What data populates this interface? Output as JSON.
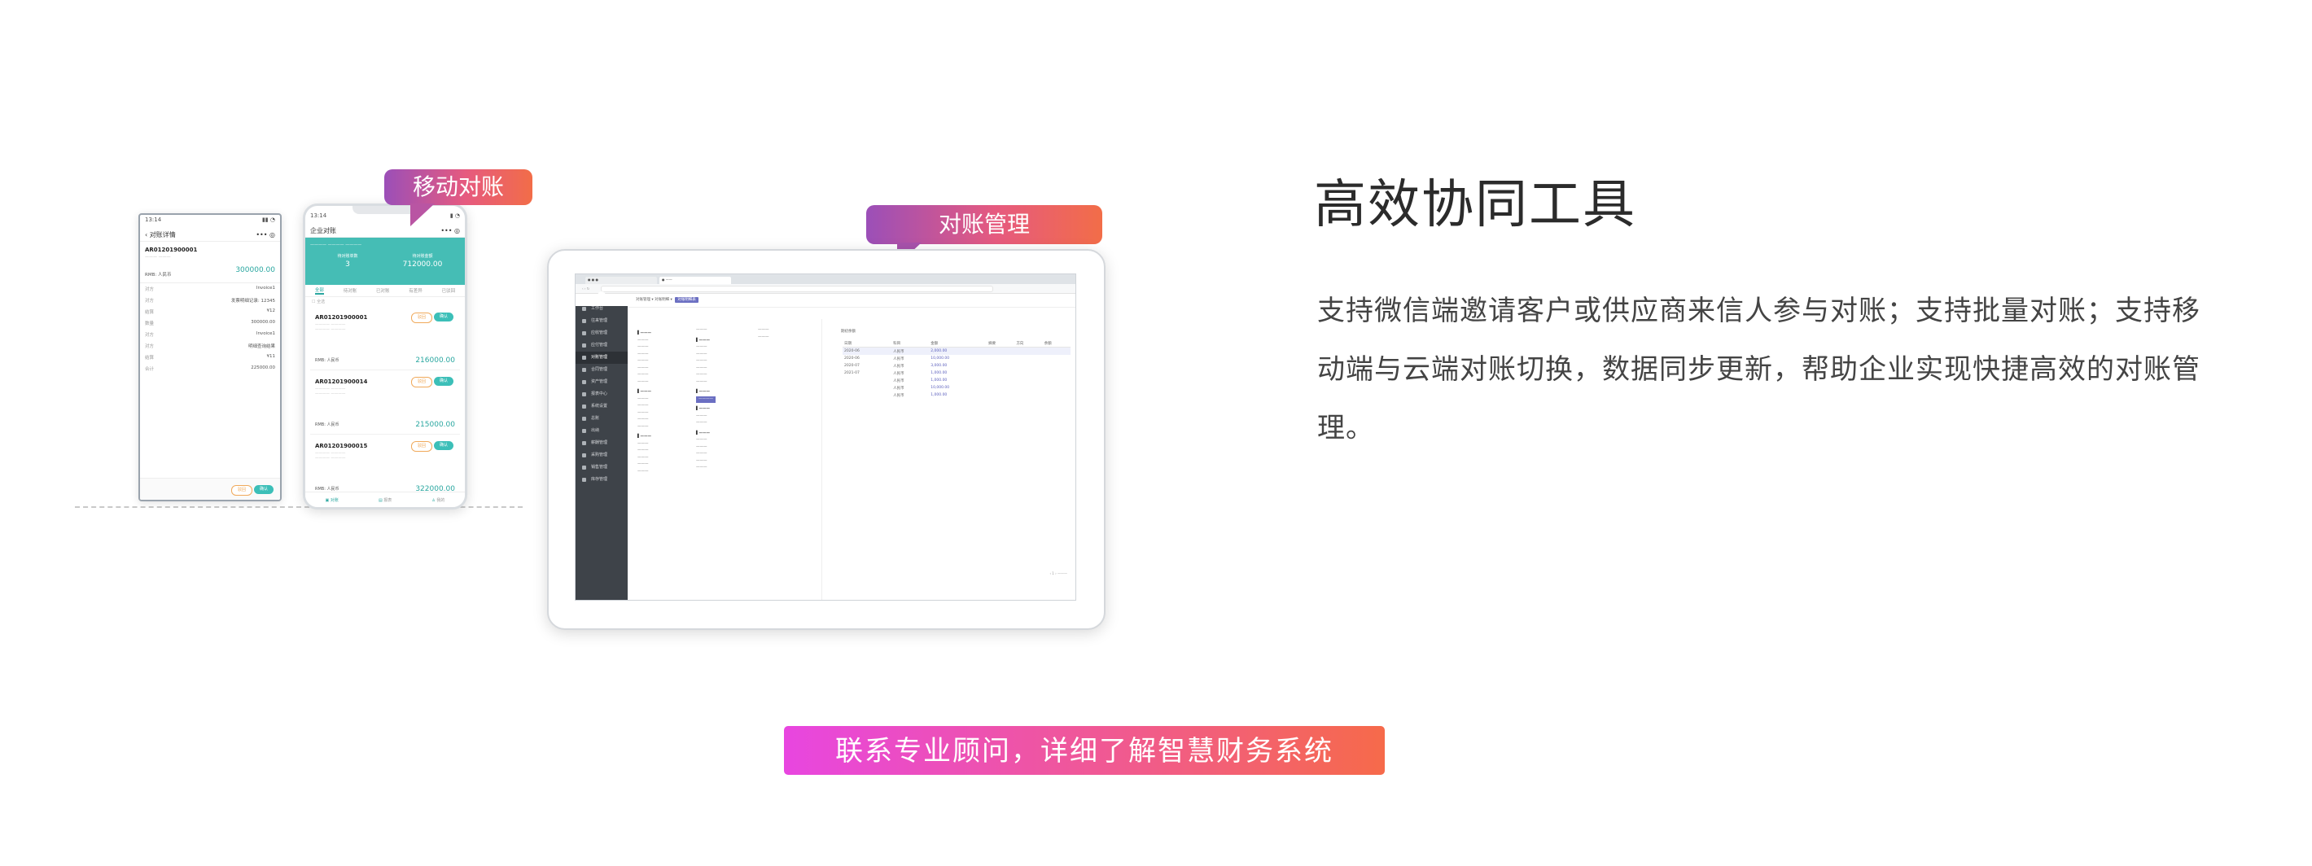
{
  "labels": {
    "mobile": "移动对账",
    "web": "对账管理"
  },
  "heading": {
    "title": "高效协同工具",
    "description": "支持微信端邀请客户或供应商来信人参与对账；支持批量对账；支持移动端与云端对账切换，数据同步更新，帮助企业实现快捷高效的对账管理。"
  },
  "cta": {
    "label": "联系专业顾问，详细了解智慧财务系统"
  },
  "phone_back": {
    "time": "13:14",
    "nav_title": "对账详情",
    "doc_code": "AR01201900001",
    "amount": "300000.00",
    "unit": "RMB: 人民币",
    "rows": [
      {
        "k": "对方",
        "v": "Invoice1"
      },
      {
        "k": "对方",
        "v": "发票明细记录: 12345"
      },
      {
        "k": "结算",
        "v": "¥12"
      },
      {
        "k": "数量",
        "v": "300000.00"
      },
      {
        "k": "对方",
        "v": "Invoice1"
      },
      {
        "k": "对方",
        "v": "明细查询结果"
      },
      {
        "k": "结算",
        "v": "¥11"
      },
      {
        "k": "合计",
        "v": "225000.00"
      }
    ],
    "btn_reject": "驳回",
    "btn_confirm": "确认"
  },
  "phone_front": {
    "time": "13:14",
    "nav_title": "企业对账",
    "stat_count_label": "待对账单数",
    "stat_count": "3",
    "stat_amount_label": "待对账金额",
    "stat_amount": "712000.00",
    "tabs": [
      "全部",
      "待对账",
      "已对账",
      "有差异",
      "已驳回"
    ],
    "select_all": "全选",
    "cards": [
      {
        "id": "AR01201900001",
        "unit": "RMB: 人民币",
        "amount": "216000.00"
      },
      {
        "id": "AR01201900014",
        "unit": "RMB: 人民币",
        "amount": "215000.00"
      },
      {
        "id": "AR01201900015",
        "unit": "RMB: 人民币",
        "amount": "322000.00"
      }
    ],
    "btn_reject": "驳回",
    "btn_confirm": "确认",
    "bottom_tabs": [
      "对账",
      "报表",
      "我的"
    ]
  },
  "web_app": {
    "breadcrumb": [
      "对账管理",
      "对账明细",
      "对账明细表"
    ],
    "sidebar": [
      "工作台",
      "往来管理",
      "应收管理",
      "应付管理",
      "对账管理",
      "合同管理",
      "资产管理",
      "报表中心",
      "系统设置",
      "总账",
      "出纳",
      "薪酬管理",
      "采购管理",
      "销售管理",
      "库存管理"
    ],
    "grid_header": "期初余额",
    "columns": [
      "日期",
      "科目",
      "金额",
      "摘要",
      "方向",
      "余额"
    ],
    "rows": [
      {
        "date": "2020-06",
        "subject": "人民币",
        "amount": "2,000.00"
      },
      {
        "date": "2020-06",
        "subject": "人民币",
        "amount": "10,000.00"
      },
      {
        "date": "2020-07",
        "subject": "人民币",
        "amount": "3,000.00"
      },
      {
        "date": "2021-07",
        "subject": "人民币",
        "amount": "1,000.00"
      },
      {
        "date": "",
        "subject": "人民币",
        "amount": "1,000.00"
      },
      {
        "date": "",
        "subject": "人民币",
        "amount": "10,000.00"
      },
      {
        "date": "",
        "subject": "人民币",
        "amount": "1,000.00"
      }
    ]
  }
}
